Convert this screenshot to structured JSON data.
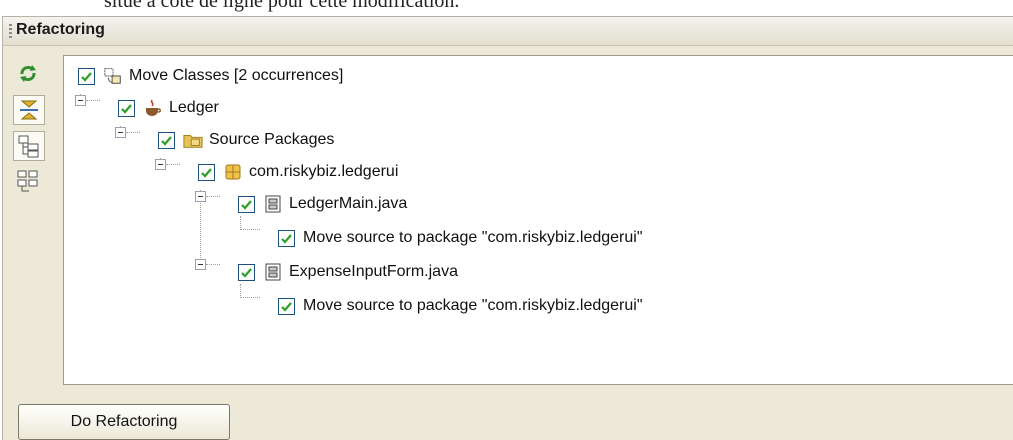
{
  "page_top_text": "situé à côté de ligne pour cette modification.",
  "panel": {
    "title": "Refactoring"
  },
  "toolbar": {
    "buttons": [
      {
        "icon": "refresh-icon"
      },
      {
        "icon": "collapse-expand-icon",
        "selected": true
      },
      {
        "icon": "logical-view-icon",
        "selected": true
      },
      {
        "icon": "file-view-icon"
      }
    ]
  },
  "tree": {
    "root_label": "Move Classes [2 occurrences]",
    "project_label": "Ledger",
    "source_label": "Source Packages",
    "package_label": "com.riskybiz.ledgerui",
    "file1_label": "LedgerMain.java",
    "file1_change": "Move source to package \"com.riskybiz.ledgerui\"",
    "file2_label": "ExpenseInputForm.java",
    "file2_change": "Move source to package \"com.riskybiz.ledgerui\"",
    "all_checked": true
  },
  "actions": {
    "do_refactoring_label": "Do Refactoring"
  },
  "colors": {
    "check": "#2aa02a",
    "checkbox_border": "#1c5180",
    "panel_bg": "#ece9d8"
  }
}
